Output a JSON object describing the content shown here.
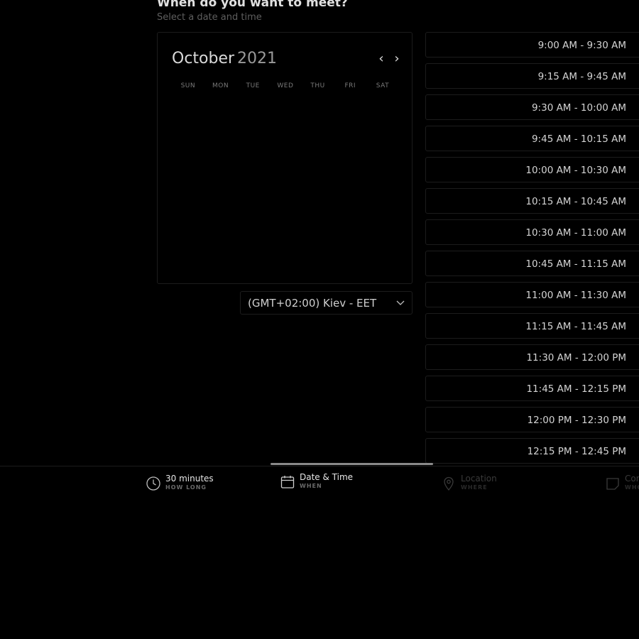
{
  "header": {
    "title": "When do you want to meet?",
    "subtitle": "Select a date and time"
  },
  "calendar": {
    "month": "October",
    "year": "2021",
    "prev_icon": "chevron-left-icon",
    "next_icon": "chevron-right-icon",
    "weekdays": [
      "SUN",
      "MON",
      "TUE",
      "WED",
      "THU",
      "FRI",
      "SAT"
    ]
  },
  "timezone": {
    "value": "(GMT+02:00) Kiev - EET",
    "icon": "chevron-down-icon"
  },
  "time_slots": [
    "9:00 AM - 9:30 AM",
    "9:15 AM - 9:45 AM",
    "9:30 AM - 10:00 AM",
    "9:45 AM - 10:15 AM",
    "10:00 AM - 10:30 AM",
    "10:15 AM - 10:45 AM",
    "10:30 AM - 11:00 AM",
    "10:45 AM - 11:15 AM",
    "11:00 AM - 11:30 AM",
    "11:15 AM - 11:45 AM",
    "11:30 AM - 12:00 PM",
    "11:45 AM - 12:15 PM",
    "12:00 PM - 12:30 PM",
    "12:15 PM - 12:45 PM"
  ],
  "steps": [
    {
      "label": "30 minutes",
      "sublabel": "HOW LONG",
      "icon": "clock-icon",
      "state": "done"
    },
    {
      "label": "Date & Time",
      "sublabel": "WHEN",
      "icon": "calendar-icon",
      "state": "active"
    },
    {
      "label": "Location",
      "sublabel": "WHERE",
      "icon": "location-pin-icon",
      "state": "upcoming"
    },
    {
      "label": "Con",
      "sublabel": "WHO",
      "icon": "contact-card-icon",
      "state": "upcoming"
    }
  ],
  "colors": {
    "background": "#000000",
    "border": "#1c1c1c",
    "text": "#e6e6e6",
    "muted": "#5e5e5e",
    "progress": "#8a8a8a"
  }
}
